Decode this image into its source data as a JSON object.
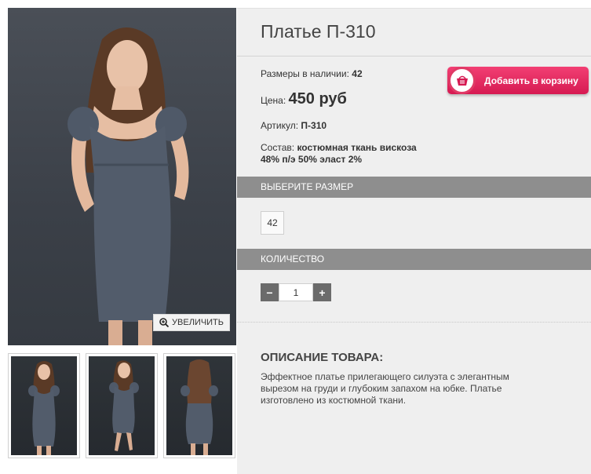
{
  "product": {
    "title": "Платье П-310",
    "sizes_label": "Размеры в наличии:",
    "sizes_value": "42",
    "price_label": "Цена:",
    "price_value": "450 руб",
    "sku_label": "Артикул:",
    "sku_value": "П-310",
    "composition_label": "Состав:",
    "composition_line1": "костюмная ткань вискоза",
    "composition_line2": "48% п/э 50% эласт 2%"
  },
  "cart_button": {
    "label": "Добавить в корзину",
    "icon": "basket-icon",
    "color": "#e8275d"
  },
  "gallery": {
    "zoom_label": "УВЕЛИЧИТЬ",
    "zoom_icon": "magnifier-plus-icon",
    "thumbnails": [
      "front",
      "side",
      "back"
    ]
  },
  "size_section": {
    "header": "ВЫБЕРИТЕ РАЗМЕР",
    "options": [
      "42"
    ]
  },
  "quantity_section": {
    "header": "КОЛИЧЕСТВО",
    "minus": "−",
    "plus": "+",
    "value": "1"
  },
  "description": {
    "title": "ОПИСАНИЕ ТОВАРА:",
    "line1": "Эффектное платье прилегающего силуэта с элегантным",
    "line2": "вырезом на груди и глубоким запахом на юбке. Платье",
    "line3": "изготовлено из костюмной ткани."
  },
  "colors": {
    "section_bar": "#8e8e8e",
    "panel": "#efefef",
    "accent": "#e8275d"
  }
}
